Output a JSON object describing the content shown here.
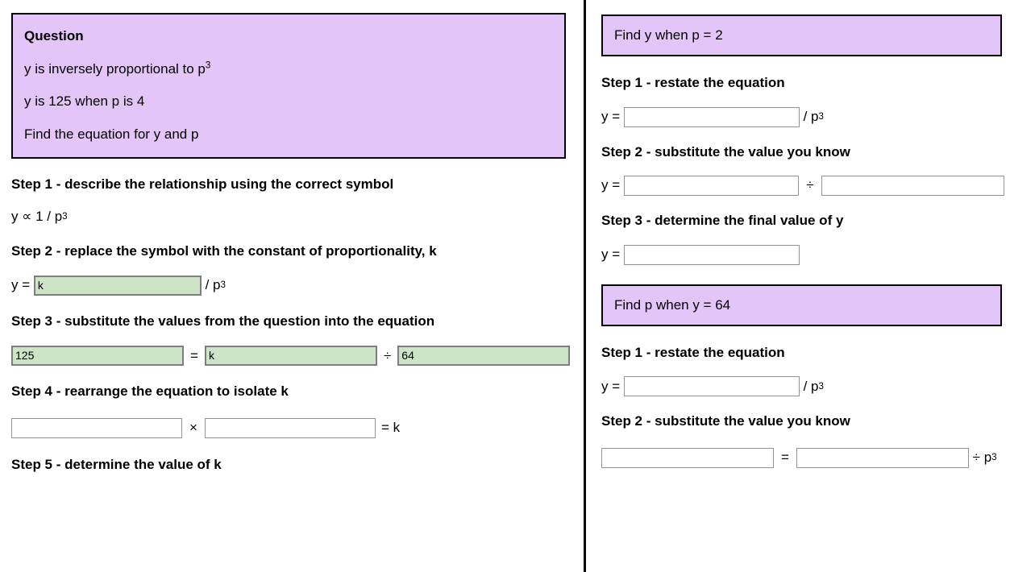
{
  "layout": {
    "colors": {
      "prompt_background": "#e4c5f7",
      "prompt_border": "#000000",
      "filled_input_background": "#cde5c6",
      "filled_input_border": "#7e7e7e",
      "empty_input_border": "#949494",
      "divider": "#000000",
      "page_background": "#ffffff"
    }
  },
  "left": {
    "question": {
      "title": "Question",
      "line1_prefix": "y is inversely proportional to p",
      "line1_exponent": "3",
      "line2": "y is 125 when p is 4",
      "line3": "Find the equation for y and p"
    },
    "step1": {
      "heading": "Step 1 - describe the relationship using the correct symbol",
      "expression": "y ∝ 1 / p",
      "exponent": "3"
    },
    "step2": {
      "heading": "Step 2 - replace the symbol with the constant of proportionality, k",
      "lhs_label": "y = ",
      "input_value": "k",
      "suffix": " / p",
      "exponent": "3"
    },
    "step3": {
      "heading": "Step 3 - substitute the values from the question into the equation",
      "input1_value": "125",
      "operator1": "=",
      "input2_value": "k",
      "operator2": "÷",
      "input3_value": "64"
    },
    "step4": {
      "heading": "Step 4 - rearrange the equation to isolate k",
      "input1_value": "",
      "input1_placeholder": "",
      "operator1": "×",
      "input2_value": "",
      "input2_placeholder": "",
      "suffix": "= k"
    },
    "step5": {
      "heading": "Step 5 - determine the value of k"
    }
  },
  "right": {
    "task1": {
      "prompt": "Find y when p = 2",
      "step1": {
        "heading": "Step 1 - restate the equation",
        "lhs_label": "y = ",
        "input_value": "",
        "input_placeholder": "",
        "suffix": " / p",
        "exponent": "3"
      },
      "step2": {
        "heading": "Step 2 - substitute the value you know",
        "lhs_label": "y = ",
        "input1_value": "",
        "input1_placeholder": "",
        "operator": "÷",
        "input2_value": "",
        "input2_placeholder": ""
      },
      "step3": {
        "heading": "Step 3 - determine the final value of y",
        "lhs_label": "y = ",
        "input_value": "",
        "input_placeholder": ""
      }
    },
    "task2": {
      "prompt": "Find p when y = 64",
      "step1": {
        "heading": "Step 1 - restate the equation",
        "lhs_label": "y = ",
        "input_value": "",
        "input_placeholder": "",
        "suffix": " / p",
        "exponent": "3"
      },
      "step2": {
        "heading": "Step 2 - substitute the value you know",
        "input1_value": "",
        "input1_placeholder": "",
        "operator": "=",
        "input2_value": "",
        "input2_placeholder": "",
        "suffix": " ÷ p",
        "exponent": "3"
      }
    }
  }
}
